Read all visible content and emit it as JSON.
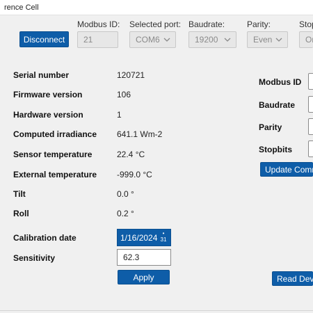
{
  "window": {
    "title": "rence Cell"
  },
  "connection": {
    "disconnect_label": "Disconnect",
    "modbus_id": {
      "label": "Modbus ID:",
      "value": "21"
    },
    "port": {
      "label": "Selected port:",
      "value": "COM6"
    },
    "baudrate": {
      "label": "Baudrate:",
      "value": "19200"
    },
    "parity": {
      "label": "Parity:",
      "value": "Even"
    },
    "stopbits": {
      "label": "Stop",
      "value": "On"
    }
  },
  "device_info": {
    "rows": [
      {
        "label": "Serial number",
        "value": "120721"
      },
      {
        "label": "Firmware version",
        "value": "106"
      },
      {
        "label": "Hardware version",
        "value": "1"
      },
      {
        "label": "Computed irradiance",
        "value": "641.1 Wm-2"
      },
      {
        "label": "Sensor temperature",
        "value": "22.4 °C"
      },
      {
        "label": "External temperature",
        "value": "-999.0 °C"
      },
      {
        "label": "Tilt",
        "value": "0.0 °"
      },
      {
        "label": "Roll",
        "value": "0.2 °"
      }
    ]
  },
  "calibration": {
    "date_label": "Calibration date",
    "date_value": "1/16/2024",
    "calendar_day": "31",
    "sensitivity_label": "Sensitivity",
    "sensitivity_value": "62.3",
    "apply_label": "Apply"
  },
  "comm_settings": {
    "labels": [
      "Modbus ID",
      "Baudrate",
      "Parity",
      "Stopbits"
    ],
    "update_label": "Update Comm",
    "read_label": "Read Devi"
  },
  "colors": {
    "accent": "#0e5da8",
    "disabled_bg": "#e7e7e7",
    "window_bg": "#f0f0f0"
  }
}
